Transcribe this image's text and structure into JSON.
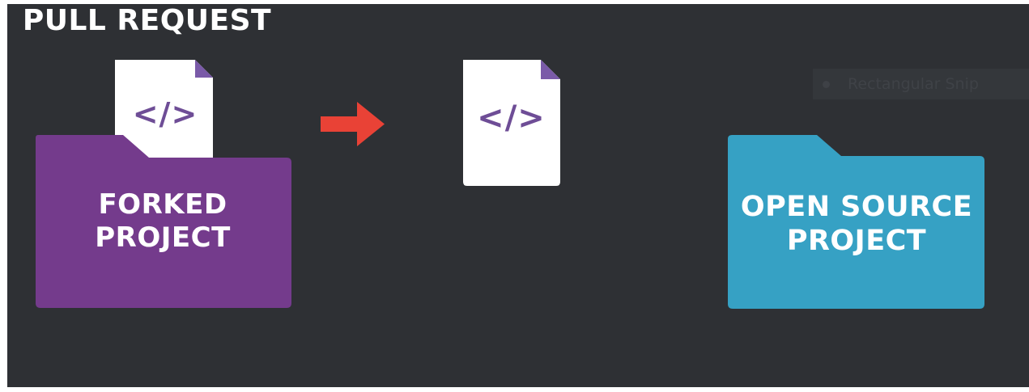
{
  "diagram": {
    "forked_project": {
      "label": "FORKED\nPROJECT",
      "color": "#743b8c"
    },
    "pull_request": {
      "label": "PULL REQUEST"
    },
    "open_source_project": {
      "label": "OPEN SOURCE\nPROJECT",
      "color": "#36a1c4"
    },
    "code_icon": {
      "glyph": "</>",
      "color": "#6e4d96"
    },
    "arrow_color": "#e94236",
    "background_color": "#2e3034",
    "overlay_tooltip": {
      "text": "Rectangular Snip"
    }
  }
}
